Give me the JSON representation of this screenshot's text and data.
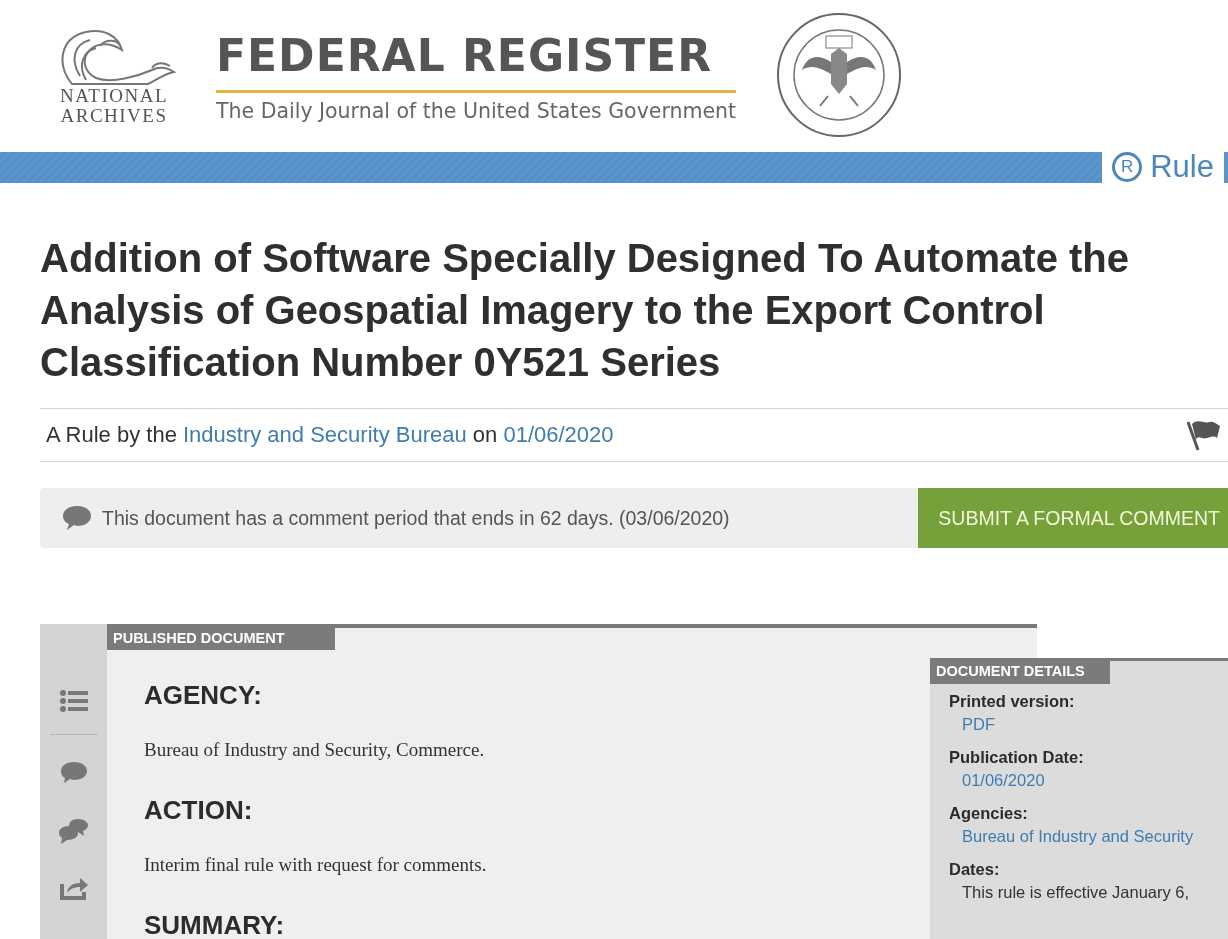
{
  "header": {
    "logo_lines": [
      "NATIONAL",
      "ARCHIVES"
    ],
    "title": "FEDERAL REGISTER",
    "tagline": "The Daily Journal of the United States Government"
  },
  "document_type": {
    "letter": "R",
    "label": "Rule"
  },
  "document_title": "Addition of Software Specially Designed To Automate the Analysis of Geospatial Imagery to the Export Control Classification Number 0Y521 Series",
  "byline": {
    "prefix": "A Rule by the",
    "agency": "Industry and Security Bureau",
    "connector": "on",
    "date": "01/06/2020"
  },
  "comment_notice": {
    "text": "This document has a comment period that ends in 62 days. (03/06/2020)",
    "button": "SUBMIT A FORMAL COMMENT"
  },
  "document": {
    "tab": "PUBLISHED DOCUMENT",
    "sections": [
      {
        "heading": "AGENCY:",
        "body": "Bureau of Industry and Security, Commerce."
      },
      {
        "heading": "ACTION:",
        "body": "Interim final rule with request for comments."
      },
      {
        "heading": "SUMMARY:"
      }
    ]
  },
  "details": {
    "tab": "DOCUMENT DETAILS",
    "fields": [
      {
        "label": "Printed version:",
        "value": "PDF",
        "kind": "link"
      },
      {
        "label": "Publication Date:",
        "value": "01/06/2020",
        "kind": "link"
      },
      {
        "label": "Agencies:",
        "value": "Bureau of Industry and Security",
        "kind": "link"
      },
      {
        "label": "Dates:",
        "value": "This rule is effective January 6,",
        "kind": "text"
      }
    ]
  }
}
